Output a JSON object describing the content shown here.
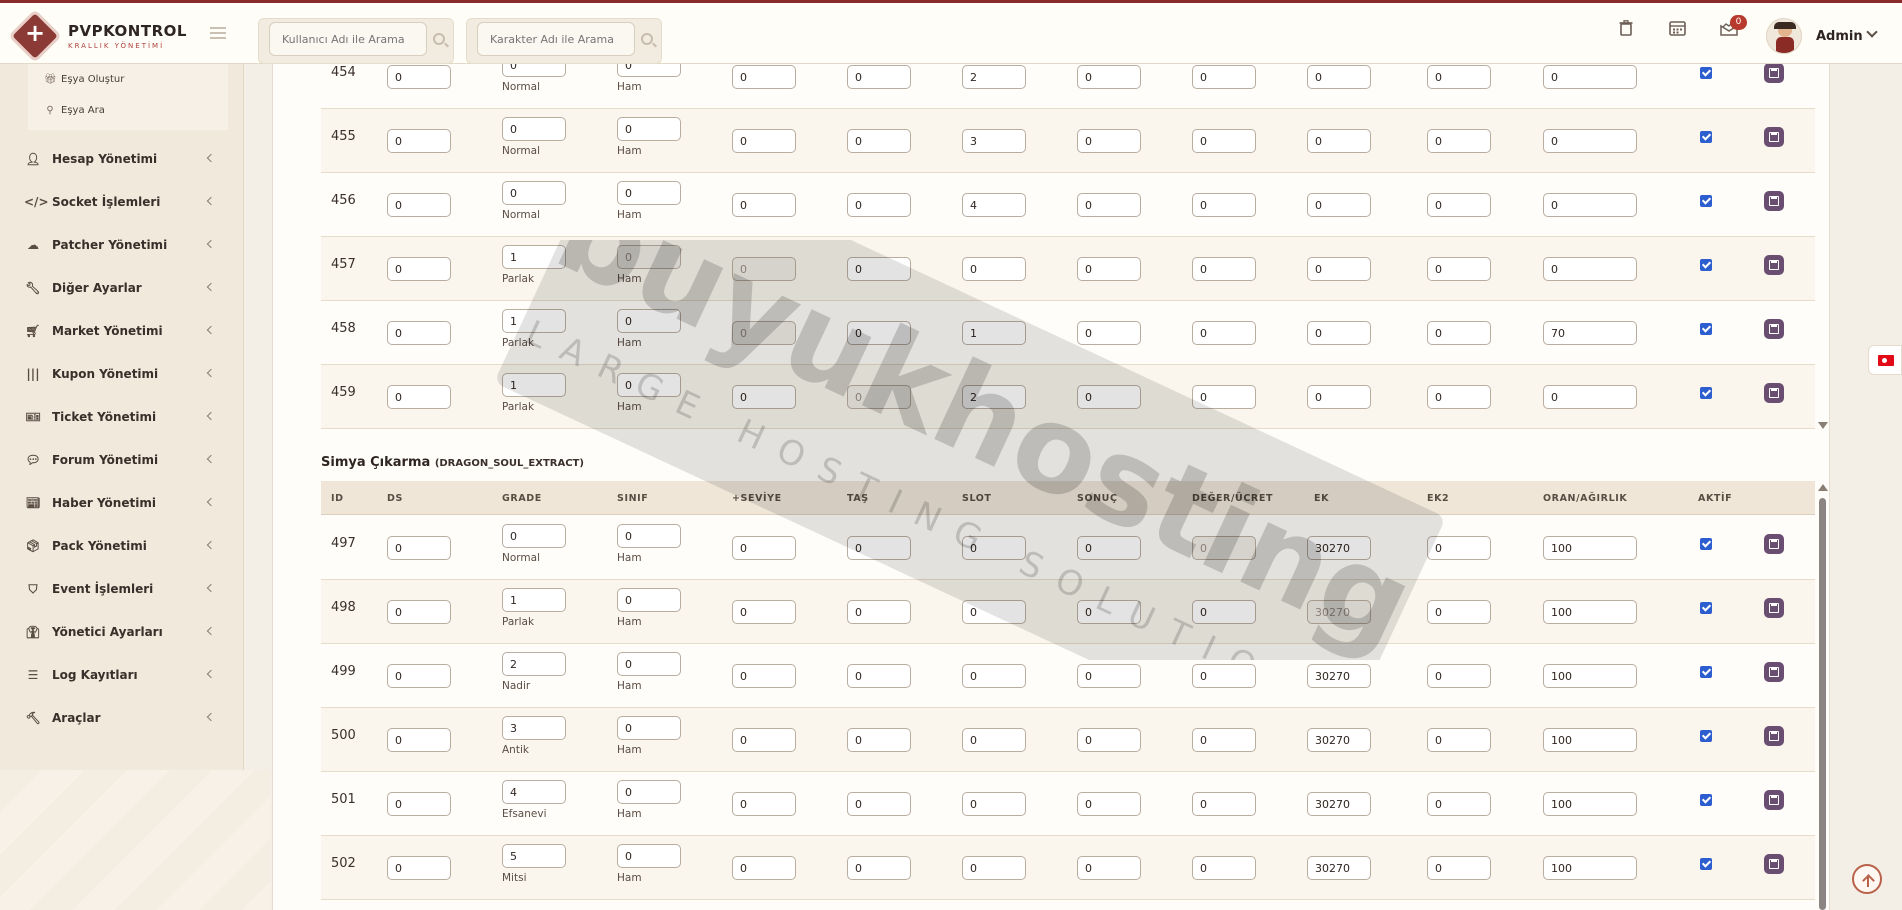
{
  "brand": {
    "name": "PVPKONTROL",
    "subtitle": "KRALLIK YÖNETİMİ"
  },
  "search": {
    "user_placeholder": "Kullanıcı Adı ile Arama",
    "char_placeholder": "Karakter Adı ile Arama"
  },
  "header": {
    "icons": [
      "trash-icon",
      "calendar-icon",
      "mail-chart-icon"
    ],
    "notification_count": "0",
    "admin_name": "Admin"
  },
  "sidebar": {
    "subitems": [
      {
        "icon": "gift-icon",
        "label": "Eşya Oluştur"
      },
      {
        "icon": "search-icon",
        "label": "Eşya Ara"
      }
    ],
    "items": [
      {
        "icon": "user-icon",
        "label": "Hesap Yönetimi"
      },
      {
        "icon": "code-icon",
        "label": "Socket İşlemleri"
      },
      {
        "icon": "cloud-icon",
        "label": "Patcher Yönetimi"
      },
      {
        "icon": "wrench-icon",
        "label": "Diğer Ayarlar"
      },
      {
        "icon": "cart-icon",
        "label": "Market Yönetimi"
      },
      {
        "icon": "barcode-icon",
        "label": "Kupon Yönetimi"
      },
      {
        "icon": "ticket-icon",
        "label": "Ticket Yönetimi"
      },
      {
        "icon": "comments-icon",
        "label": "Forum Yönetimi"
      },
      {
        "icon": "newspaper-icon",
        "label": "Haber Yönetimi"
      },
      {
        "icon": "box-icon",
        "label": "Pack Yönetimi"
      },
      {
        "icon": "shield-icon",
        "label": "Event İşlemleri"
      },
      {
        "icon": "user-tie-icon",
        "label": "Yönetici Ayarları"
      },
      {
        "icon": "list-icon",
        "label": "Log Kayıtları"
      },
      {
        "icon": "tools-icon",
        "label": "Araçlar"
      }
    ]
  },
  "upper_table": {
    "rows": [
      {
        "id": "454",
        "ds": "0",
        "grade": "0",
        "grade_name": "Normal",
        "sinif": "0",
        "sinif_name": "Ham",
        "seviye": "0",
        "tas": "0",
        "slot": "2",
        "sonuc": "0",
        "deger": "0",
        "ek": "0",
        "ek2": "0",
        "oran": "0"
      },
      {
        "id": "455",
        "ds": "0",
        "grade": "0",
        "grade_name": "Normal",
        "sinif": "0",
        "sinif_name": "Ham",
        "seviye": "0",
        "tas": "0",
        "slot": "3",
        "sonuc": "0",
        "deger": "0",
        "ek": "0",
        "ek2": "0",
        "oran": "0"
      },
      {
        "id": "456",
        "ds": "0",
        "grade": "0",
        "grade_name": "Normal",
        "sinif": "0",
        "sinif_name": "Ham",
        "seviye": "0",
        "tas": "0",
        "slot": "4",
        "sonuc": "0",
        "deger": "0",
        "ek": "0",
        "ek2": "0",
        "oran": "0"
      },
      {
        "id": "457",
        "ds": "0",
        "grade": "1",
        "grade_name": "Parlak",
        "sinif": "0",
        "sinif_name": "Ham",
        "seviye": "0",
        "tas": "0",
        "slot": "0",
        "sonuc": "0",
        "deger": "0",
        "ek": "0",
        "ek2": "0",
        "oran": "0"
      },
      {
        "id": "458",
        "ds": "0",
        "grade": "1",
        "grade_name": "Parlak",
        "sinif": "0",
        "sinif_name": "Ham",
        "seviye": "0",
        "tas": "0",
        "slot": "1",
        "sonuc": "0",
        "deger": "0",
        "ek": "0",
        "ek2": "0",
        "oran": "70"
      },
      {
        "id": "459",
        "ds": "0",
        "grade": "1",
        "grade_name": "Parlak",
        "sinif": "0",
        "sinif_name": "Ham",
        "seviye": "0",
        "tas": "0",
        "slot": "2",
        "sonuc": "0",
        "deger": "0",
        "ek": "0",
        "ek2": "0",
        "oran": "0"
      }
    ]
  },
  "section": {
    "title": "Simya Çıkarma",
    "code": "(DRAGON_SOUL_EXTRACT)",
    "columns": [
      "ID",
      "DS",
      "GRADE",
      "SINIF",
      "+SEVİYE",
      "TAŞ",
      "SLOT",
      "SONUÇ",
      "DEĞER/ÜCRET",
      "EK",
      "EK2",
      "ORAN/AĞIRLIK",
      "AKTİF"
    ],
    "rows": [
      {
        "id": "497",
        "ds": "0",
        "grade": "0",
        "grade_name": "Normal",
        "sinif": "0",
        "sinif_name": "Ham",
        "seviye": "0",
        "tas": "0",
        "slot": "0",
        "sonuc": "0",
        "deger": "0",
        "ek": "30270",
        "ek2": "0",
        "oran": "100"
      },
      {
        "id": "498",
        "ds": "0",
        "grade": "1",
        "grade_name": "Parlak",
        "sinif": "0",
        "sinif_name": "Ham",
        "seviye": "0",
        "tas": "0",
        "slot": "0",
        "sonuc": "0",
        "deger": "0",
        "ek": "30270",
        "ek2": "0",
        "oran": "100"
      },
      {
        "id": "499",
        "ds": "0",
        "grade": "2",
        "grade_name": "Nadir",
        "sinif": "0",
        "sinif_name": "Ham",
        "seviye": "0",
        "tas": "0",
        "slot": "0",
        "sonuc": "0",
        "deger": "0",
        "ek": "30270",
        "ek2": "0",
        "oran": "100"
      },
      {
        "id": "500",
        "ds": "0",
        "grade": "3",
        "grade_name": "Antik",
        "sinif": "0",
        "sinif_name": "Ham",
        "seviye": "0",
        "tas": "0",
        "slot": "0",
        "sonuc": "0",
        "deger": "0",
        "ek": "30270",
        "ek2": "0",
        "oran": "100"
      },
      {
        "id": "501",
        "ds": "0",
        "grade": "4",
        "grade_name": "Efsanevi",
        "sinif": "0",
        "sinif_name": "Ham",
        "seviye": "0",
        "tas": "0",
        "slot": "0",
        "sonuc": "0",
        "deger": "0",
        "ek": "30270",
        "ek2": "0",
        "oran": "100"
      },
      {
        "id": "502",
        "ds": "0",
        "grade": "5",
        "grade_name": "Mitsi",
        "sinif": "0",
        "sinif_name": "Ham",
        "seviye": "0",
        "tas": "0",
        "slot": "0",
        "sonuc": "0",
        "deger": "0",
        "ek": "30270",
        "ek2": "0",
        "oran": "100"
      }
    ]
  },
  "watermark": {
    "brand": "buyukhosting",
    "tagline": "LARGE HOSTING SOLUTIONS"
  },
  "colors": {
    "accent": "#8b2a2a",
    "save_button": "#6a4e72",
    "checkbox": "#2d5ecf"
  }
}
